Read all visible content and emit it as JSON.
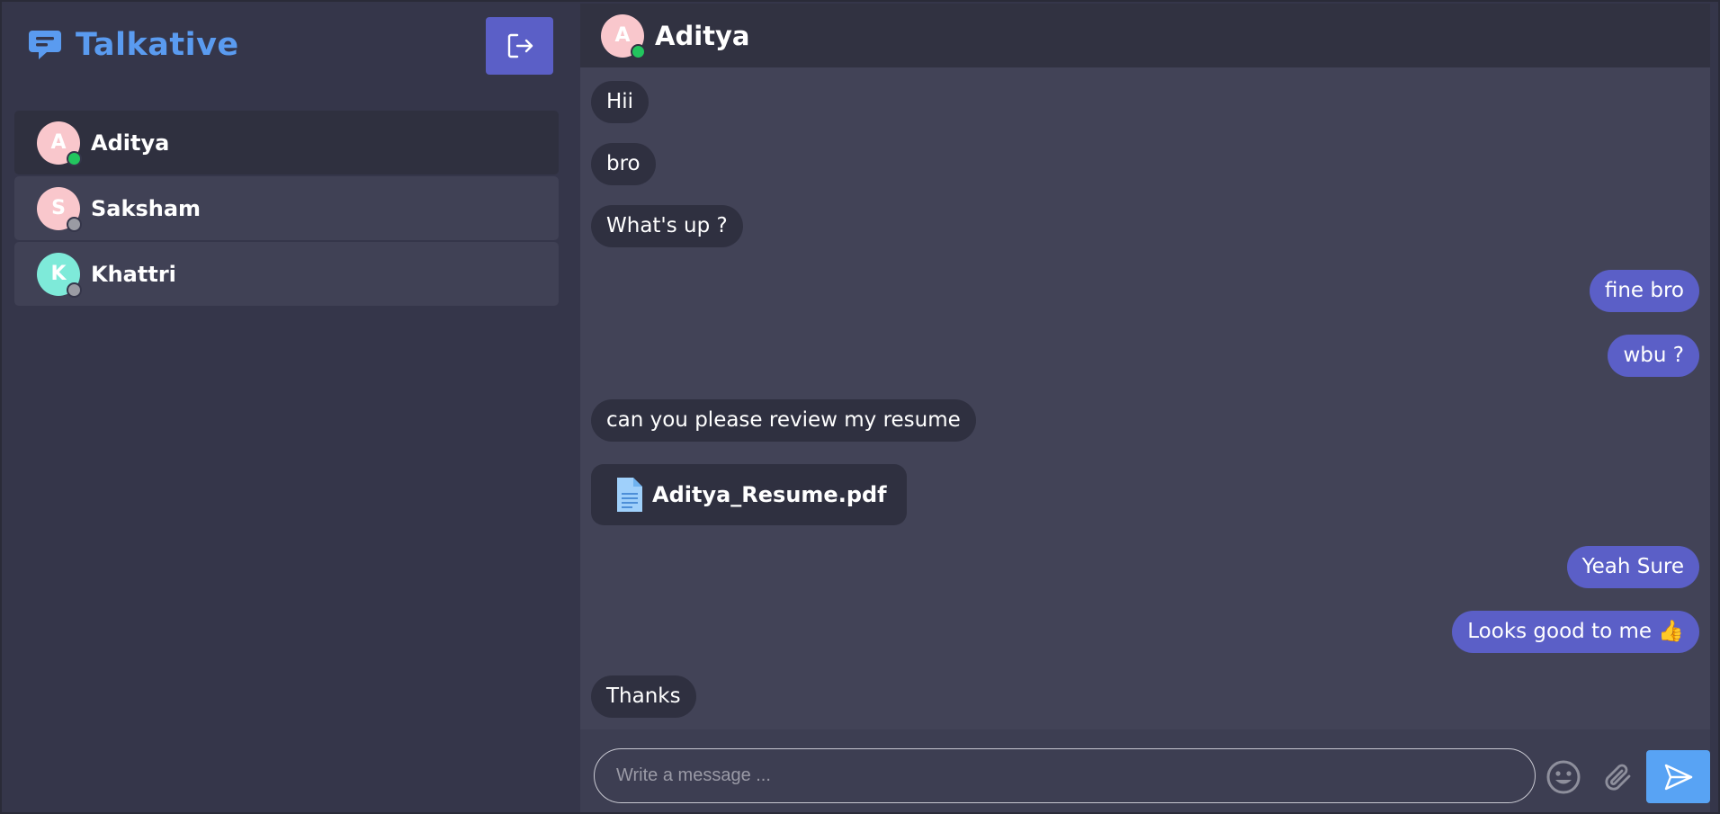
{
  "brand": {
    "name": "Talkative",
    "icon": "chat-bubble-icon",
    "color": "#5a9bf0"
  },
  "logout": {
    "icon": "logout-icon",
    "color": "#5b5fc7"
  },
  "contacts": [
    {
      "name": "Aditya",
      "initial": "A",
      "avatar_color": "#f9c7cc",
      "status": "online",
      "status_color": "#22c55e",
      "active": true
    },
    {
      "name": "Saksham",
      "initial": "S",
      "avatar_color": "#f9c7cc",
      "status": "offline",
      "status_color": "#9a9ba3",
      "active": false
    },
    {
      "name": "Khattri",
      "initial": "K",
      "avatar_color": "#7eead9",
      "status": "offline",
      "status_color": "#9a9ba3",
      "active": false
    }
  ],
  "chat": {
    "header": {
      "name": "Aditya",
      "initial": "A",
      "avatar_color": "#f9c7cc",
      "status": "online",
      "status_color": "#22c55e"
    },
    "messages": [
      {
        "direction": "in",
        "text": "Hii"
      },
      {
        "direction": "in",
        "text": "bro"
      },
      {
        "direction": "in",
        "text": "What's up ?"
      },
      {
        "direction": "out",
        "text": "fine bro"
      },
      {
        "direction": "out",
        "text": "wbu ?"
      },
      {
        "direction": "in",
        "text": "can you please review my resume"
      },
      {
        "direction": "in",
        "type": "file",
        "text": "Aditya_Resume.pdf",
        "icon": "document-icon"
      },
      {
        "direction": "out",
        "text": "Yeah Sure"
      },
      {
        "direction": "out",
        "text": "Looks good to me 👍"
      },
      {
        "direction": "in",
        "text": "Thanks"
      }
    ]
  },
  "composer": {
    "placeholder": "Write a message ...",
    "value": "",
    "emoji_icon": "emoji-icon",
    "attach_icon": "paperclip-icon",
    "send_icon": "send-icon",
    "send_color": "#58a3f4"
  }
}
